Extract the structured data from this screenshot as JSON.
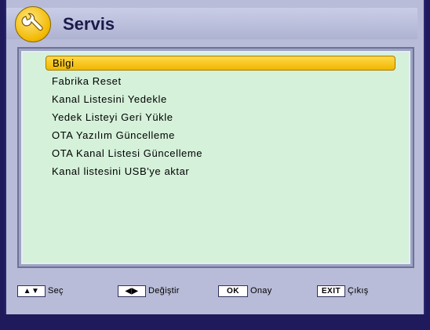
{
  "header": {
    "title": "Servis",
    "icon": "wrench-icon"
  },
  "menu": {
    "items": [
      {
        "label": "Bilgi",
        "selected": true
      },
      {
        "label": "Fabrika Reset",
        "selected": false
      },
      {
        "label": "Kanal Listesini Yedekle",
        "selected": false
      },
      {
        "label": "Yedek Listeyi Geri Yükle",
        "selected": false
      },
      {
        "label": "OTA Yazılım Güncelleme",
        "selected": false
      },
      {
        "label": "OTA Kanal Listesi Güncelleme",
        "selected": false
      },
      {
        "label": "Kanal listesini USB'ye aktar",
        "selected": false
      }
    ]
  },
  "footer": {
    "hints": [
      {
        "key": "▲▼",
        "key_icon": "up-down-arrow-icon",
        "label": "Seç"
      },
      {
        "key": "◀▶",
        "key_icon": "left-right-arrow-icon",
        "label": "Değiştir"
      },
      {
        "key": "OK",
        "label": "Onay"
      },
      {
        "key": "EXIT",
        "label": "Çıkış"
      }
    ]
  },
  "colors": {
    "background": "#1e1a5c",
    "frame": "#b8bcd8",
    "panel": "#d5f1da",
    "highlight": "#f0b800"
  }
}
